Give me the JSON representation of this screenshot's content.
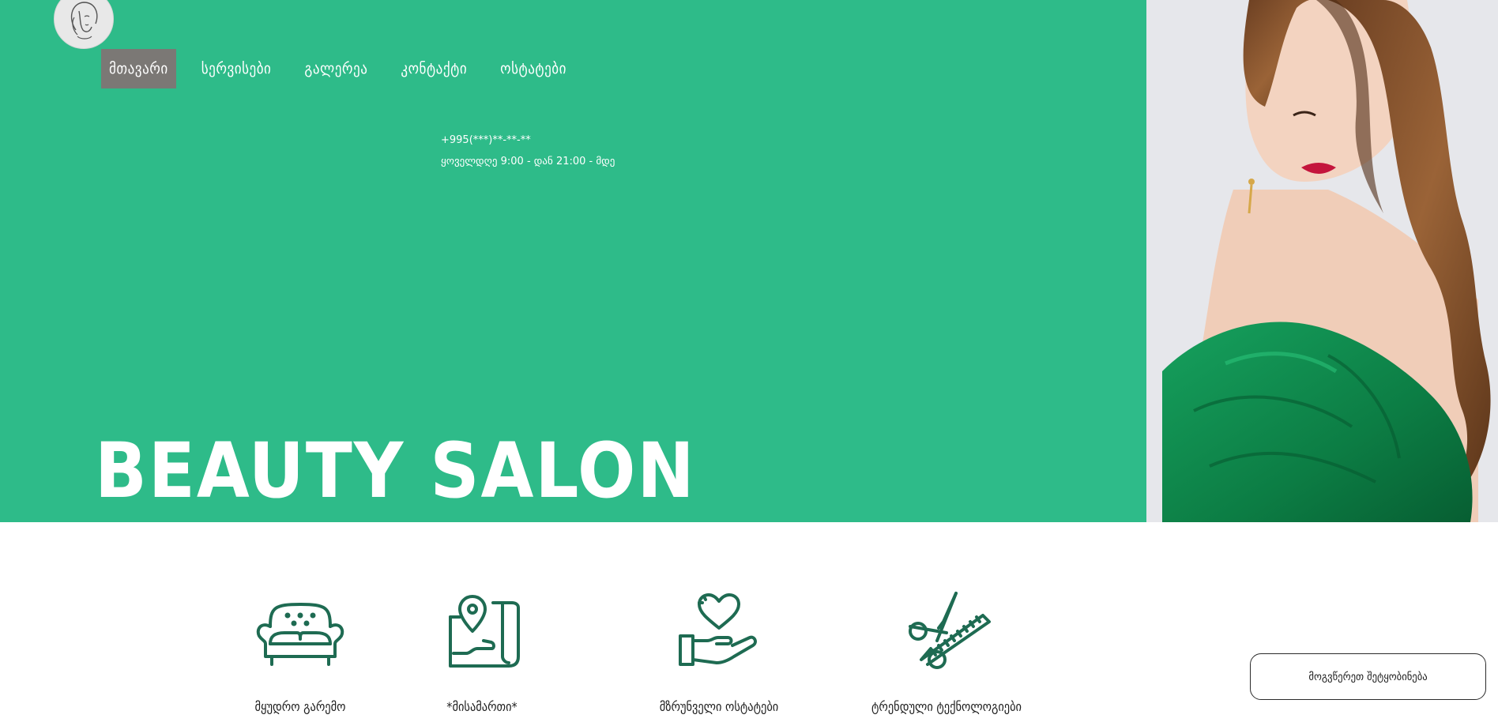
{
  "nav": {
    "items": [
      {
        "label": "მთავარი",
        "active": true
      },
      {
        "label": "სერვისები",
        "active": false
      },
      {
        "label": "გალერეა",
        "active": false
      },
      {
        "label": "კონტაქტი",
        "active": false
      },
      {
        "label": "ოსტატები",
        "active": false
      }
    ]
  },
  "contact": {
    "phone": "+995(***)**-**-**",
    "hours": "ყოველდღე 9:00 - დან 21:00 - მდე"
  },
  "hero": {
    "title": "BEAUTY SALON"
  },
  "features": [
    {
      "label": "მყუდრო გარემო",
      "icon": "sofa-icon"
    },
    {
      "label": "*მისამართი*",
      "icon": "map-pin-icon"
    },
    {
      "label": "მზრუნველი ოსტატები",
      "icon": "hand-heart-icon"
    },
    {
      "label": "ტრენდული ტექნოლოგიები",
      "icon": "scissors-comb-icon"
    }
  ],
  "cta": {
    "label": "მოგვწერეთ შეტყობინება"
  },
  "colors": {
    "hero_bg": "#2ebb89",
    "nav_active_bg": "#7b7875",
    "icon_color": "#1e6b52",
    "dress_green": "#0f8a4d"
  }
}
